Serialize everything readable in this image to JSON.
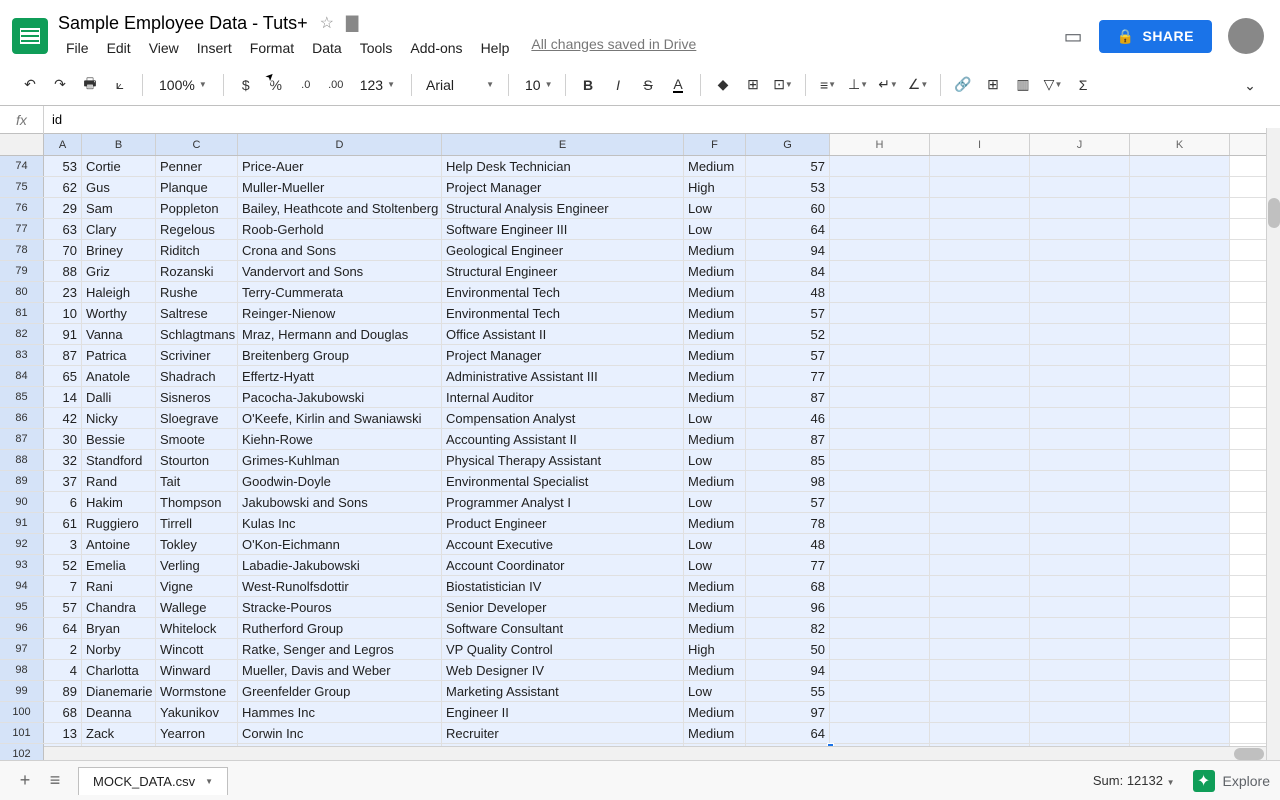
{
  "doc": {
    "title": "Sample Employee Data - Tuts+"
  },
  "menu": {
    "file": "File",
    "edit": "Edit",
    "view": "View",
    "insert": "Insert",
    "format": "Format",
    "data": "Data",
    "tools": "Tools",
    "addons": "Add-ons",
    "help": "Help",
    "saved": "All changes saved in Drive"
  },
  "share": {
    "label": "SHARE"
  },
  "toolbar": {
    "zoom": "100%",
    "font": "Arial",
    "size": "10",
    "fmt123": "123"
  },
  "formula": {
    "fx": "fx",
    "value": "id"
  },
  "columns": [
    "A",
    "B",
    "C",
    "D",
    "E",
    "F",
    "G",
    "H",
    "I",
    "J",
    "K"
  ],
  "rows": [
    {
      "n": 74,
      "a": 53,
      "b": "Cortie",
      "c": "Penner",
      "d": "Price-Auer",
      "e": "Help Desk Technician",
      "f": "Medium",
      "g": 57
    },
    {
      "n": 75,
      "a": 62,
      "b": "Gus",
      "c": "Planque",
      "d": "Muller-Mueller",
      "e": "Project Manager",
      "f": "High",
      "g": 53
    },
    {
      "n": 76,
      "a": 29,
      "b": "Sam",
      "c": "Poppleton",
      "d": "Bailey, Heathcote and Stoltenberg",
      "e": "Structural Analysis Engineer",
      "f": "Low",
      "g": 60
    },
    {
      "n": 77,
      "a": 63,
      "b": "Clary",
      "c": "Regelous",
      "d": "Roob-Gerhold",
      "e": "Software Engineer III",
      "f": "Low",
      "g": 64
    },
    {
      "n": 78,
      "a": 70,
      "b": "Briney",
      "c": "Riditch",
      "d": "Crona and Sons",
      "e": "Geological Engineer",
      "f": "Medium",
      "g": 94
    },
    {
      "n": 79,
      "a": 88,
      "b": "Griz",
      "c": "Rozanski",
      "d": "Vandervort and Sons",
      "e": "Structural Engineer",
      "f": "Medium",
      "g": 84
    },
    {
      "n": 80,
      "a": 23,
      "b": "Haleigh",
      "c": "Rushe",
      "d": "Terry-Cummerata",
      "e": "Environmental Tech",
      "f": "Medium",
      "g": 48
    },
    {
      "n": 81,
      "a": 10,
      "b": "Worthy",
      "c": "Saltrese",
      "d": "Reinger-Nienow",
      "e": "Environmental Tech",
      "f": "Medium",
      "g": 57
    },
    {
      "n": 82,
      "a": 91,
      "b": "Vanna",
      "c": "Schlagtmans",
      "d": "Mraz, Hermann and Douglas",
      "e": "Office Assistant II",
      "f": "Medium",
      "g": 52
    },
    {
      "n": 83,
      "a": 87,
      "b": "Patrica",
      "c": "Scriviner",
      "d": "Breitenberg Group",
      "e": "Project Manager",
      "f": "Medium",
      "g": 57
    },
    {
      "n": 84,
      "a": 65,
      "b": "Anatole",
      "c": "Shadrach",
      "d": "Effertz-Hyatt",
      "e": "Administrative Assistant III",
      "f": "Medium",
      "g": 77
    },
    {
      "n": 85,
      "a": 14,
      "b": "Dalli",
      "c": "Sisneros",
      "d": "Pacocha-Jakubowski",
      "e": "Internal Auditor",
      "f": "Medium",
      "g": 87
    },
    {
      "n": 86,
      "a": 42,
      "b": "Nicky",
      "c": "Sloegrave",
      "d": "O'Keefe, Kirlin and Swaniawski",
      "e": "Compensation Analyst",
      "f": "Low",
      "g": 46
    },
    {
      "n": 87,
      "a": 30,
      "b": "Bessie",
      "c": "Smoote",
      "d": "Kiehn-Rowe",
      "e": "Accounting Assistant II",
      "f": "Medium",
      "g": 87
    },
    {
      "n": 88,
      "a": 32,
      "b": "Standford",
      "c": "Stourton",
      "d": "Grimes-Kuhlman",
      "e": "Physical Therapy Assistant",
      "f": "Low",
      "g": 85
    },
    {
      "n": 89,
      "a": 37,
      "b": "Rand",
      "c": "Tait",
      "d": "Goodwin-Doyle",
      "e": "Environmental Specialist",
      "f": "Medium",
      "g": 98
    },
    {
      "n": 90,
      "a": 6,
      "b": "Hakim",
      "c": "Thompson",
      "d": "Jakubowski and Sons",
      "e": "Programmer Analyst I",
      "f": "Low",
      "g": 57
    },
    {
      "n": 91,
      "a": 61,
      "b": "Ruggiero",
      "c": "Tirrell",
      "d": "Kulas Inc",
      "e": "Product Engineer",
      "f": "Medium",
      "g": 78
    },
    {
      "n": 92,
      "a": 3,
      "b": "Antoine",
      "c": "Tokley",
      "d": "O'Kon-Eichmann",
      "e": "Account Executive",
      "f": "Low",
      "g": 48
    },
    {
      "n": 93,
      "a": 52,
      "b": "Emelia",
      "c": "Verling",
      "d": "Labadie-Jakubowski",
      "e": "Account Coordinator",
      "f": "Low",
      "g": 77
    },
    {
      "n": 94,
      "a": 7,
      "b": "Rani",
      "c": "Vigne",
      "d": "West-Runolfsdottir",
      "e": "Biostatistician IV",
      "f": "Medium",
      "g": 68
    },
    {
      "n": 95,
      "a": 57,
      "b": "Chandra",
      "c": "Wallege",
      "d": "Stracke-Pouros",
      "e": "Senior Developer",
      "f": "Medium",
      "g": 96
    },
    {
      "n": 96,
      "a": 64,
      "b": "Bryan",
      "c": "Whitelock",
      "d": "Rutherford Group",
      "e": "Software Consultant",
      "f": "Medium",
      "g": 82
    },
    {
      "n": 97,
      "a": 2,
      "b": "Norby",
      "c": "Wincott",
      "d": "Ratke, Senger and Legros",
      "e": "VP Quality Control",
      "f": "High",
      "g": 50
    },
    {
      "n": 98,
      "a": 4,
      "b": "Charlotta",
      "c": "Winward",
      "d": "Mueller, Davis and Weber",
      "e": "Web Designer IV",
      "f": "Medium",
      "g": 94
    },
    {
      "n": 99,
      "a": 89,
      "b": "Dianemarie",
      "c": "Wormstone",
      "d": "Greenfelder Group",
      "e": "Marketing Assistant",
      "f": "Low",
      "g": 55
    },
    {
      "n": 100,
      "a": 68,
      "b": "Deanna",
      "c": "Yakunikov",
      "d": "Hammes Inc",
      "e": "Engineer II",
      "f": "Medium",
      "g": 97
    },
    {
      "n": 101,
      "a": 13,
      "b": "Zack",
      "c": "Yearron",
      "d": "Corwin Inc",
      "e": "Recruiter",
      "f": "Medium",
      "g": 64
    },
    {
      "n": 102,
      "a": "",
      "b": "",
      "c": "",
      "d": "",
      "e": "",
      "f": "",
      "g": ""
    }
  ],
  "footer": {
    "sheet": "MOCK_DATA.csv",
    "sum": "Sum: 12132",
    "explore": "Explore"
  }
}
